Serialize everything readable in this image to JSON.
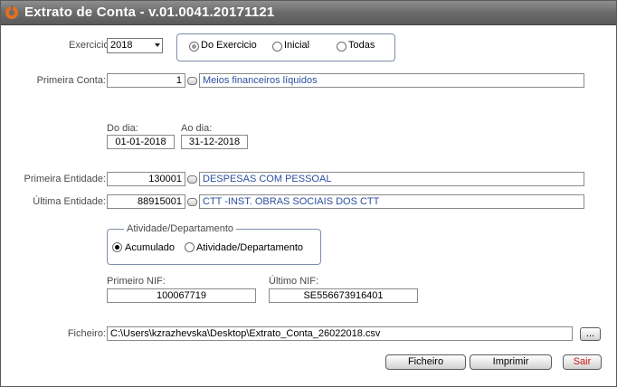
{
  "window": {
    "title": "Extrato de Conta - v.01.0041.20171121"
  },
  "exercicio": {
    "label": "Exercicio:",
    "value": "2018",
    "options": {
      "do_exercicio": "Do Exercicio",
      "inicial": "Inicial",
      "todas": "Todas"
    }
  },
  "primeira_conta": {
    "label": "Primeira Conta:",
    "value": "1",
    "description": "Meios financeiros líquidos"
  },
  "dates": {
    "from_label": "Do dia:",
    "from_value": "01-01-2018",
    "to_label": "Ao dia:",
    "to_value": "31-12-2018"
  },
  "primeira_entidade": {
    "label": "Primeira Entidade:",
    "value": "130001",
    "description": "DESPESAS COM PESSOAL"
  },
  "ultima_entidade": {
    "label": "Última Entidade:",
    "value": "88915001",
    "description": "CTT -INST. OBRAS SOCIAIS DOS CTT"
  },
  "atividade": {
    "legend": "Atividade/Departamento",
    "acumulado": "Acumulado",
    "atividade_departamento": "Atividade/Departamento"
  },
  "nif": {
    "first_label": "Primeiro NIF:",
    "first_value": "100067719",
    "last_label": "Último NIF:",
    "last_value": "SE556673916401"
  },
  "ficheiro": {
    "label": "Ficheiro:",
    "value": "C:\\Users\\kzrazhevska\\Desktop\\Extrato_Conta_26022018.csv",
    "browse_label": "..."
  },
  "buttons": {
    "ficheiro": "Ficheiro",
    "imprimir": "Imprimir",
    "sair": "Sair"
  },
  "colors": {
    "title_bar": "#6b6b6b",
    "description_text": "#2c4fa0",
    "exit_text": "#d01010"
  }
}
